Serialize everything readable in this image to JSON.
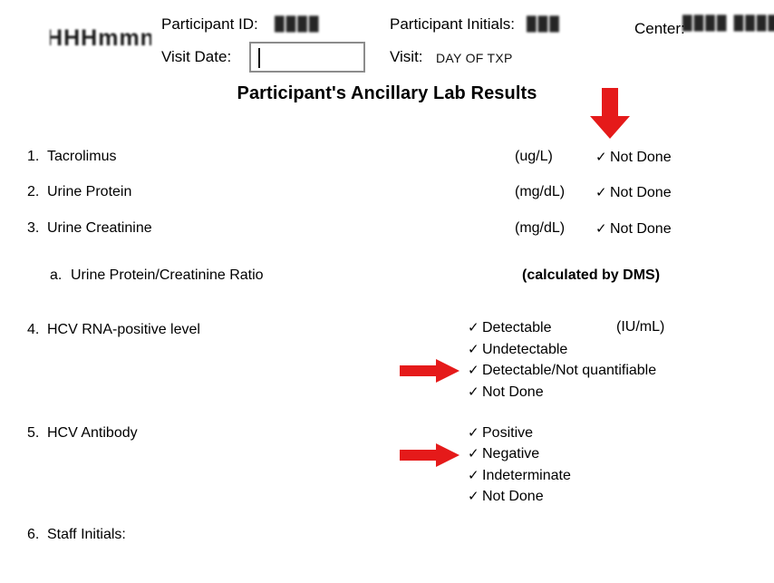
{
  "header": {
    "logo_text": "HHHmmn",
    "participant_id_label": "Participant ID:",
    "participant_id_value": "████",
    "visit_date_label": "Visit Date:",
    "visit_date_value": "",
    "participant_initials_label": "Participant Initials:",
    "participant_initials_value": "███",
    "center_label": "Center:",
    "center_value": "████ ████",
    "visit_label": "Visit:",
    "visit_value": "DAY OF TXP"
  },
  "title": "Participant's Ancillary Lab Results",
  "rows": [
    {
      "number": "1.",
      "label": "Tacrolimus",
      "unit": "(ug/L)",
      "option": "Not Done",
      "check": "✓"
    },
    {
      "number": "2.",
      "label": "Urine Protein",
      "unit": "(mg/dL)",
      "option": "Not Done",
      "check": "✓"
    },
    {
      "number": "3.",
      "label": "Urine Creatinine",
      "unit": "(mg/dL)",
      "option": "Not Done",
      "check": "✓"
    }
  ],
  "subrow": {
    "number": "a.",
    "label": "Urine Protein/Creatinine Ratio",
    "note": "(calculated by DMS)"
  },
  "item4": {
    "number": "4.",
    "label": "HCV RNA-positive level",
    "unit": "(IU/mL)",
    "options": [
      {
        "label": "Detectable",
        "check": "✓"
      },
      {
        "label": "Undetectable",
        "check": "✓"
      },
      {
        "label": "Detectable/Not quantifiable",
        "check": "✓"
      },
      {
        "label": "Not Done",
        "check": "✓"
      }
    ]
  },
  "item5": {
    "number": "5.",
    "label": "HCV Antibody",
    "options": [
      {
        "label": "Positive",
        "check": "✓"
      },
      {
        "label": "Negative",
        "check": "✓"
      },
      {
        "label": "Indeterminate",
        "check": "✓"
      },
      {
        "label": "Not Done",
        "check": "✓"
      }
    ]
  },
  "item6": {
    "number": "6.",
    "label": "Staff Initials:"
  },
  "annotations": {
    "arrow_color": "#E51A1A",
    "down_arrow_target": "Not Done",
    "right_arrow_1_target": "Detectable/Not quantifiable",
    "right_arrow_2_target": "Negative"
  }
}
